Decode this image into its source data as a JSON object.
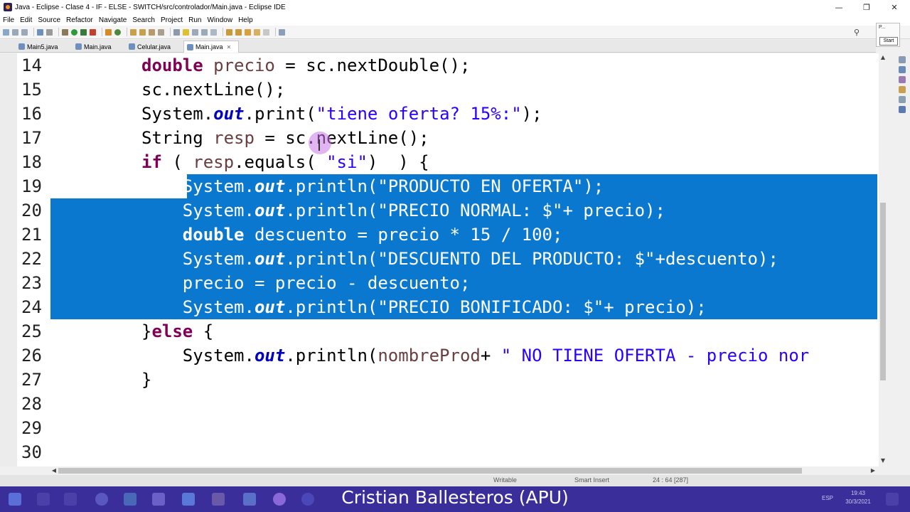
{
  "window": {
    "title": "Java - Eclipse - Clase 4 - IF - ELSE - SWITCH/src/controlador/Main.java - Eclipse IDE",
    "minimize": "—",
    "maximize": "❐",
    "close": "✕"
  },
  "menu": [
    "File",
    "Edit",
    "Source",
    "Refactor",
    "Navigate",
    "Search",
    "Project",
    "Run",
    "Window",
    "Help"
  ],
  "tabs": [
    {
      "label": "Main5.java",
      "active": false
    },
    {
      "label": "Main.java",
      "active": false
    },
    {
      "label": "Celular.java",
      "active": false
    },
    {
      "label": "Main.java",
      "active": true,
      "close": "✕"
    }
  ],
  "side_widget": {
    "label": "P...",
    "button": "Start"
  },
  "editor": {
    "lines": [
      {
        "n": "14",
        "tokens": [
          [
            "kw",
            "double"
          ],
          [
            "p",
            " "
          ],
          [
            "var",
            "precio"
          ],
          [
            "p",
            " = sc.nextDouble();"
          ]
        ]
      },
      {
        "n": "15",
        "tokens": [
          [
            "p",
            "sc.nextLine();"
          ]
        ]
      },
      {
        "n": "16",
        "tokens": [
          [
            "p",
            "System."
          ],
          [
            "fld",
            "out"
          ],
          [
            "p",
            ".print("
          ],
          [
            "str",
            "\"tiene oferta? 15%:\""
          ],
          [
            "p",
            ");"
          ]
        ]
      },
      {
        "n": "17",
        "tokens": [
          [
            "p",
            "String "
          ],
          [
            "var",
            "resp"
          ],
          [
            "p",
            " = sc.nextLine();"
          ]
        ]
      },
      {
        "n": "18",
        "tokens": [
          [
            "kw",
            "if"
          ],
          [
            "p",
            " ( "
          ],
          [
            "var",
            "resp"
          ],
          [
            "p",
            ".equals( "
          ],
          [
            "str",
            "\"si\""
          ],
          [
            "p",
            ")  ) {"
          ]
        ]
      },
      {
        "n": "19",
        "tokens": [
          [
            "p",
            "    System."
          ],
          [
            "fld",
            "out"
          ],
          [
            "p",
            ".println("
          ],
          [
            "str",
            "\"PRODUCTO EN OFERTA\""
          ],
          [
            "p",
            ");"
          ]
        ]
      },
      {
        "n": "20",
        "tokens": [
          [
            "p",
            "    System."
          ],
          [
            "fld",
            "out"
          ],
          [
            "p",
            ".println("
          ],
          [
            "str",
            "\"PRECIO NORMAL: $\""
          ],
          [
            "p",
            "+ "
          ],
          [
            "var",
            "precio"
          ],
          [
            "p",
            ");"
          ]
        ]
      },
      {
        "n": "21",
        "tokens": [
          [
            "p",
            "    "
          ],
          [
            "kw",
            "double"
          ],
          [
            "p",
            " "
          ],
          [
            "var",
            "descuento"
          ],
          [
            "p",
            " = "
          ],
          [
            "var",
            "precio"
          ],
          [
            "p",
            " * 15 / 100;"
          ]
        ]
      },
      {
        "n": "22",
        "tokens": [
          [
            "p",
            "    System."
          ],
          [
            "fld",
            "out"
          ],
          [
            "p",
            ".println("
          ],
          [
            "str",
            "\"DESCUENTO DEL PRODUCTO: $\""
          ],
          [
            "p",
            "+"
          ],
          [
            "var",
            "descuento"
          ],
          [
            "p",
            ");"
          ]
        ]
      },
      {
        "n": "23",
        "tokens": [
          [
            "p",
            "    "
          ],
          [
            "var",
            "precio"
          ],
          [
            "p",
            " = "
          ],
          [
            "var",
            "precio"
          ],
          [
            "p",
            " - "
          ],
          [
            "var",
            "descuento"
          ],
          [
            "p",
            ";"
          ]
        ]
      },
      {
        "n": "24",
        "tokens": [
          [
            "p",
            "    System."
          ],
          [
            "fld",
            "out"
          ],
          [
            "p",
            ".println("
          ],
          [
            "str",
            "\"PRECIO BONIFICADO: $\""
          ],
          [
            "p",
            "+ "
          ],
          [
            "var",
            "precio"
          ],
          [
            "p",
            ");"
          ]
        ]
      },
      {
        "n": "25",
        "tokens": [
          [
            "p",
            "}"
          ],
          [
            "kw",
            "else"
          ],
          [
            "p",
            " {"
          ]
        ]
      },
      {
        "n": "26",
        "tokens": [
          [
            "p",
            "    System."
          ],
          [
            "fld",
            "out"
          ],
          [
            "p",
            ".println("
          ],
          [
            "var",
            "nombreProd"
          ],
          [
            "p",
            "+ "
          ],
          [
            "str",
            "\" NO TIENE OFERTA - precio nor"
          ]
        ]
      },
      {
        "n": "27",
        "tokens": [
          [
            "p",
            "}"
          ]
        ]
      },
      {
        "n": "28",
        "tokens": []
      },
      {
        "n": "29",
        "tokens": []
      },
      {
        "n": "30",
        "tokens": []
      }
    ]
  },
  "status": {
    "writable": "Writable",
    "insert_mode": "Smart Insert",
    "position": "24 : 64 [287]"
  },
  "taskbar": {
    "clock_time": "19:43",
    "clock_date": "30/3/2021",
    "lang": "ESP"
  },
  "caption": "Cristian Ballesteros (APU)",
  "colors": {
    "selection": "#0b78d0",
    "keyword": "#7f0055",
    "string": "#2a00ff",
    "field": "#0000c0",
    "local_var": "#6a3e3e",
    "taskbar": "#3a2f9a"
  }
}
